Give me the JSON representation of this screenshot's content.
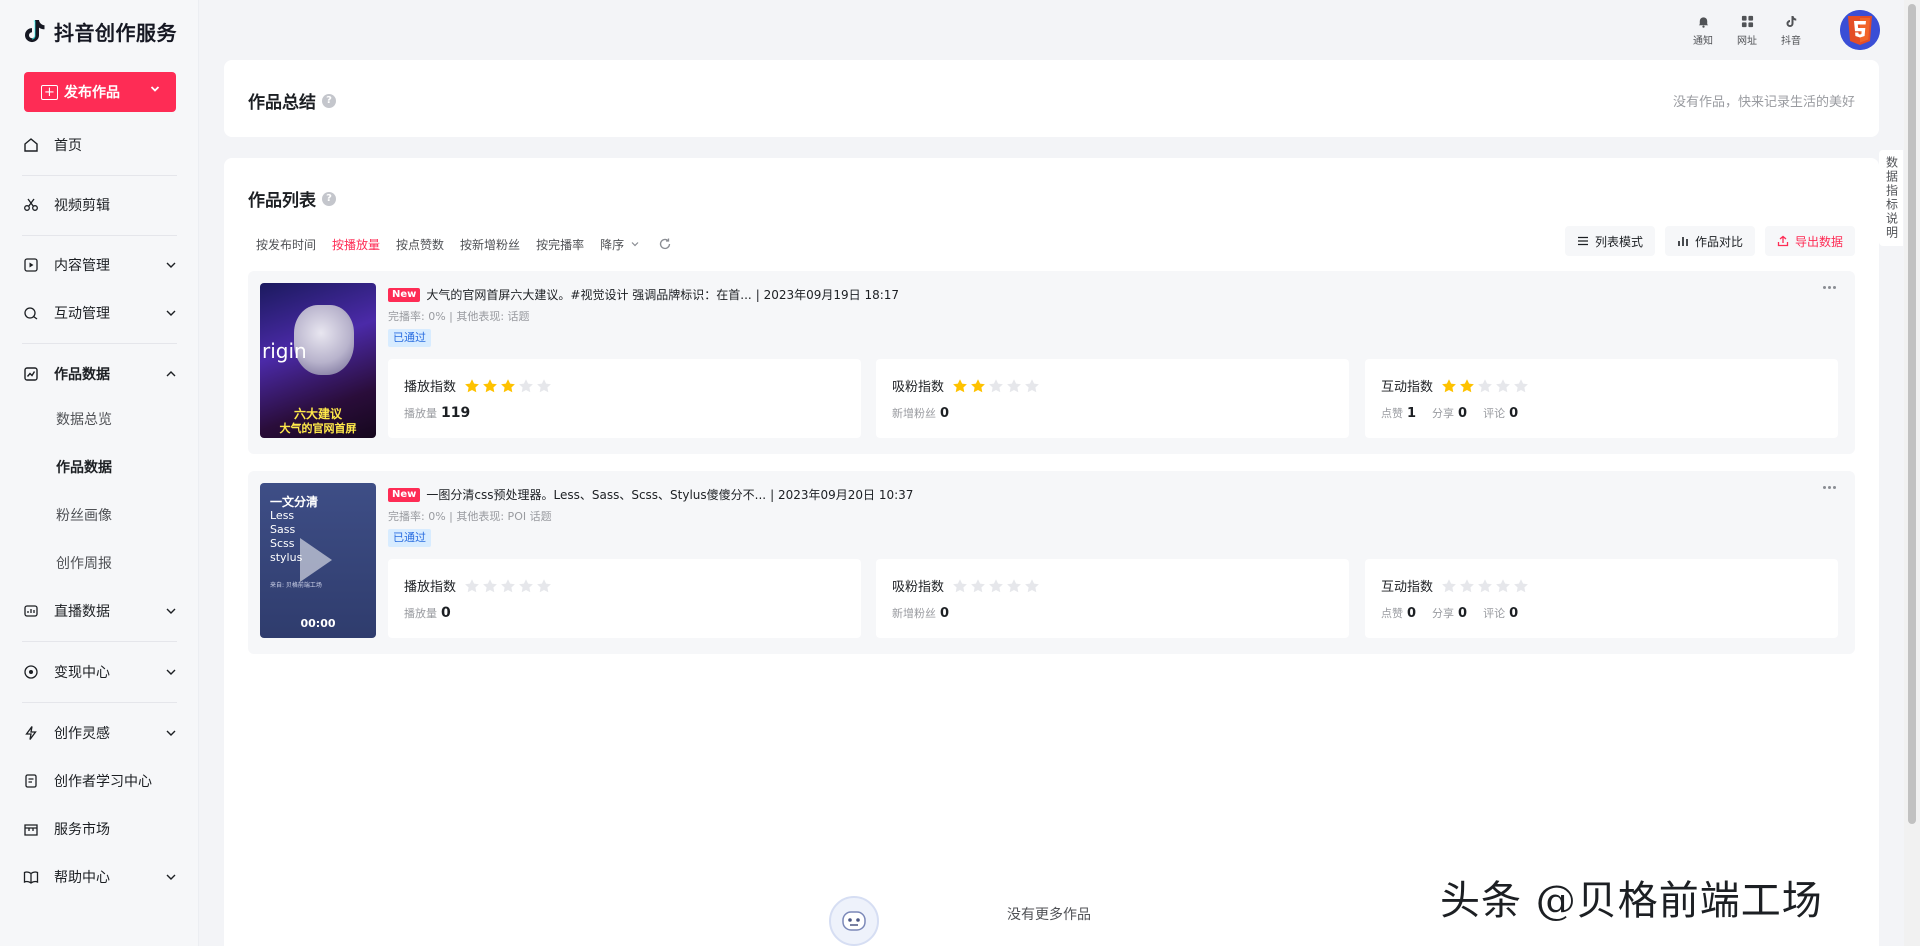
{
  "brand": {
    "name": "抖音创作服务"
  },
  "publish": {
    "label": "发布作品"
  },
  "nav": {
    "home": "首页",
    "video_edit": "视频剪辑",
    "content": "内容管理",
    "interaction": "互动管理",
    "works_data": "作品数据",
    "sub": [
      "数据总览",
      "作品数据",
      "粉丝画像",
      "创作周报"
    ],
    "live_data": "直播数据",
    "monetize": "变现中心",
    "inspiration": "创作灵感",
    "learning": "创作者学习中心",
    "market": "服务市场",
    "help": "帮助中心"
  },
  "header": {
    "notify": "通知",
    "website": "网址",
    "douyin": "抖音"
  },
  "summary": {
    "title": "作品总结",
    "empty": "没有作品，快来记录生活的美好"
  },
  "list": {
    "title": "作品列表",
    "sorts": [
      "按发布时间",
      "按播放量",
      "按点赞数",
      "按新增粉丝",
      "按完播率"
    ],
    "active_sort": 1,
    "order": "降序",
    "tools": {
      "list_mode": "列表模式",
      "compare": "作品对比",
      "export": "导出数据"
    }
  },
  "works": [
    {
      "badge": "New",
      "title": "大气的官网首屏六大建议。#视觉设计 强调品牌标识：在首...",
      "date": "| 2023年09月19日 18:17",
      "meta": "完播率: 0% | 其他表现: 话题",
      "status": "已通过",
      "thumb": {
        "word": "rigin",
        "cn1": "六大建议",
        "cn2": "大气的官网首屏"
      },
      "metrics": {
        "play": {
          "label": "播放指数",
          "stars": 3,
          "sub_label": "播放量",
          "sub_value": "119"
        },
        "fans": {
          "label": "吸粉指数",
          "stars": 2,
          "sub_label": "新增粉丝",
          "sub_value": "0"
        },
        "interact": {
          "label": "互动指数",
          "stars": 2,
          "likes_label": "点赞",
          "likes": "1",
          "share_label": "分享",
          "share": "0",
          "comment_label": "评论",
          "comment": "0"
        }
      }
    },
    {
      "badge": "New",
      "title": "一图分清css预处理器。Less、Sass、Scss、Stylus傻傻分不...",
      "date": "| 2023年09月20日 10:37",
      "meta": "完播率: 0% | 其他表现: POI 话题",
      "status": "已通过",
      "thumb": {
        "title": "一文分清",
        "lines": [
          "Less",
          "Sass",
          "Scss",
          "stylus"
        ],
        "small": "来自: 贝格前端工场",
        "duration": "00:00"
      },
      "metrics": {
        "play": {
          "label": "播放指数",
          "stars": 0,
          "sub_label": "播放量",
          "sub_value": "0"
        },
        "fans": {
          "label": "吸粉指数",
          "stars": 0,
          "sub_label": "新增粉丝",
          "sub_value": "0"
        },
        "interact": {
          "label": "互动指数",
          "stars": 0,
          "likes_label": "点赞",
          "likes": "0",
          "share_label": "分享",
          "share": "0",
          "comment_label": "评论",
          "comment": "0"
        }
      }
    }
  ],
  "no_more": "没有更多作品",
  "side_tab": "数据指标说明",
  "watermark": "头条 @贝格前端工场",
  "colors": {
    "accent": "#fe2c55",
    "star_on": "#fec200",
    "star_off": "#e6e7eb",
    "status_bg": "#d8ecff"
  }
}
